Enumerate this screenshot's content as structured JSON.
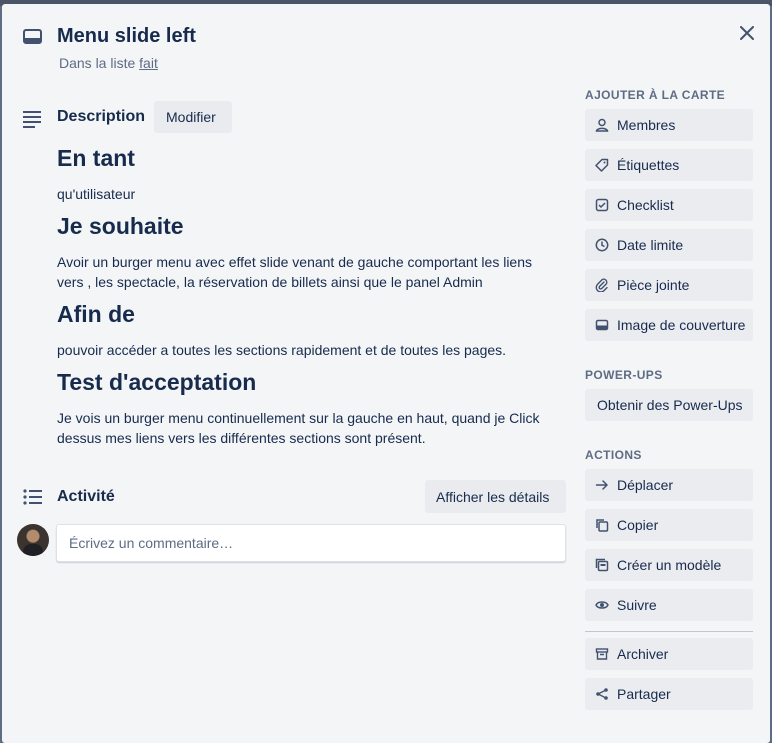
{
  "card": {
    "title": "Menu slide left",
    "in_list_prefix": "Dans la liste",
    "list_name": "fait"
  },
  "description": {
    "title": "Description",
    "edit_label": "Modifier",
    "blocks": [
      {
        "heading": "En tant",
        "text": "qu'utilisateur"
      },
      {
        "heading": "Je souhaite",
        "text": "Avoir un burger menu avec effet slide venant de gauche comportant les liens vers , les spectacle, la réservation de billets ainsi que le panel Admin"
      },
      {
        "heading": "Afin de",
        "text": "pouvoir accéder a toutes les sections rapidement et de toutes les pages."
      },
      {
        "heading": "Test d'acceptation",
        "text": "Je vois un burger menu continuellement sur la gauche en haut, quand je Click dessus mes liens vers les différentes sections sont présent."
      }
    ]
  },
  "activity": {
    "title": "Activité",
    "details_label": "Afficher les détails",
    "comment_placeholder": "Écrivez un commentaire…"
  },
  "sidebar": {
    "add_heading": "AJOUTER À LA CARTE",
    "add_items": [
      {
        "label": "Membres",
        "icon": "person-icon"
      },
      {
        "label": "Étiquettes",
        "icon": "tag-icon"
      },
      {
        "label": "Checklist",
        "icon": "checkbox-icon"
      },
      {
        "label": "Date limite",
        "icon": "clock-icon"
      },
      {
        "label": "Pièce jointe",
        "icon": "paperclip-icon"
      },
      {
        "label": "Image de couverture",
        "icon": "card-cover-icon"
      }
    ],
    "powerups_heading": "POWER-UPS",
    "powerups_label": "Obtenir des Power-Ups",
    "actions_heading": "ACTIONS",
    "action_items": [
      {
        "label": "Déplacer",
        "icon": "arrow-right-icon"
      },
      {
        "label": "Copier",
        "icon": "copy-icon"
      },
      {
        "label": "Créer un modèle",
        "icon": "template-icon"
      },
      {
        "label": "Suivre",
        "icon": "eye-icon"
      }
    ],
    "secondary_items": [
      {
        "label": "Archiver",
        "icon": "archive-icon"
      },
      {
        "label": "Partager",
        "icon": "share-icon"
      }
    ]
  },
  "colors": {
    "modal_bg": "#f4f5f7",
    "button_bg": "#ebecf0",
    "text": "#172b4d",
    "muted": "#5e6c84"
  }
}
